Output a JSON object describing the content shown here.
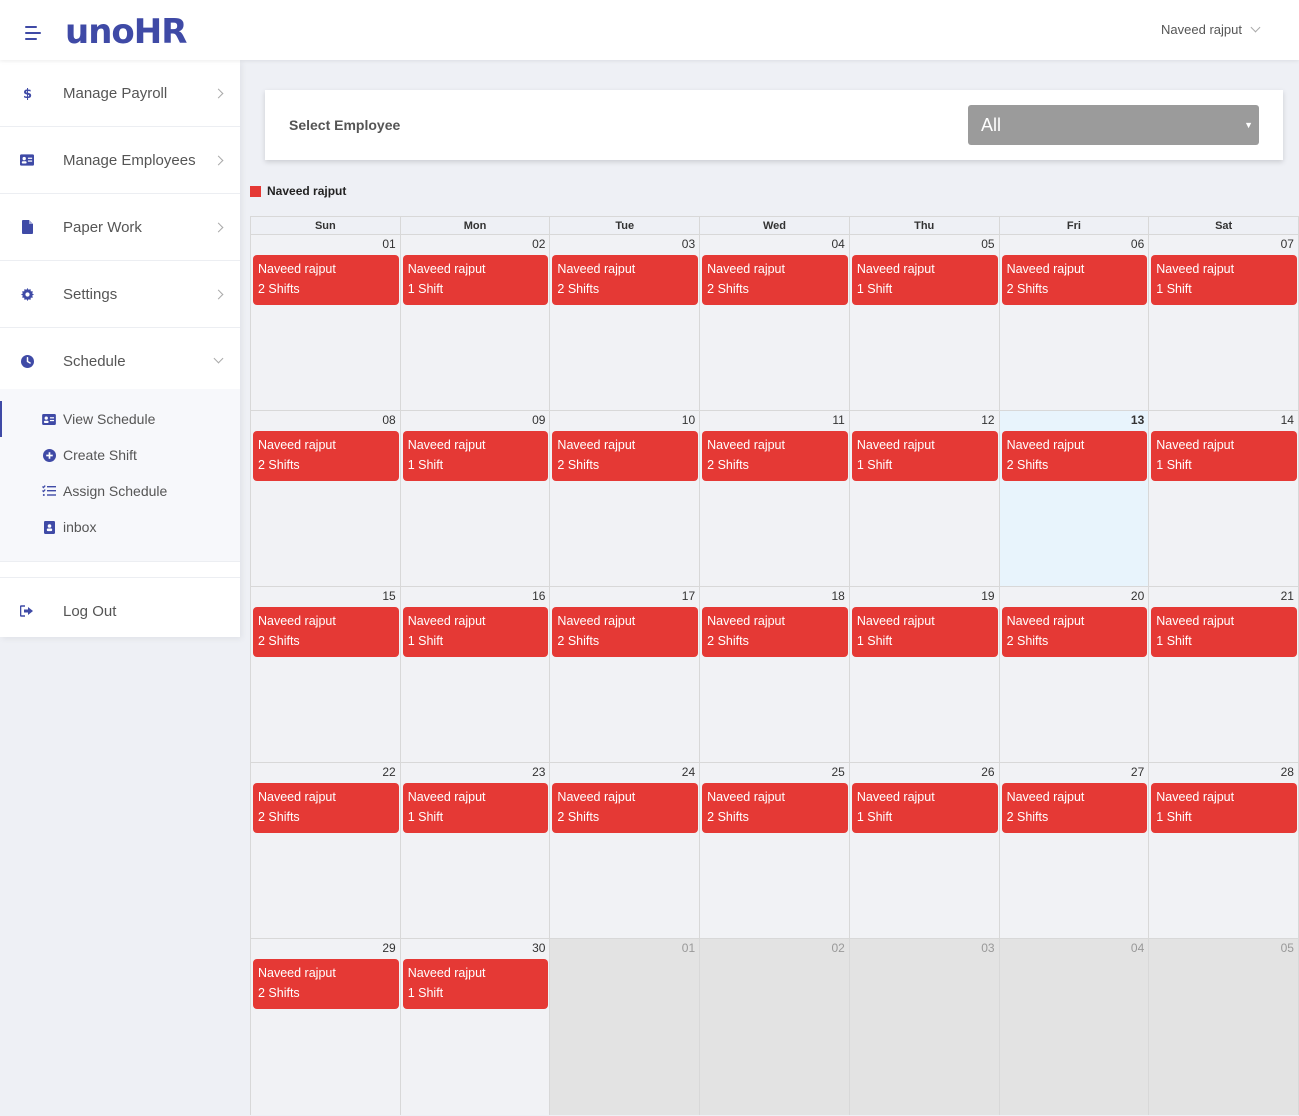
{
  "app": {
    "logo": "unoHR",
    "user_name": "Naveed rajput"
  },
  "sidebar": {
    "items": [
      {
        "label": "Manage Payroll",
        "icon": "dollar-icon"
      },
      {
        "label": "Manage Employees",
        "icon": "id-card-icon"
      },
      {
        "label": "Paper Work",
        "icon": "file-icon"
      },
      {
        "label": "Settings",
        "icon": "gear-icon"
      },
      {
        "label": "Schedule",
        "icon": "clock-icon"
      }
    ],
    "schedule_sub": [
      {
        "label": "View Schedule",
        "icon": "id-card-icon"
      },
      {
        "label": "Create Shift",
        "icon": "plus-circle-icon"
      },
      {
        "label": "Assign Schedule",
        "icon": "checklist-icon"
      },
      {
        "label": "inbox",
        "icon": "contact-book-icon"
      }
    ],
    "logout": {
      "label": "Log Out",
      "icon": "sign-out-icon"
    }
  },
  "filter": {
    "label": "Select Employee",
    "selected": "All"
  },
  "legend": {
    "label": "Naveed rajput",
    "color": "#e53935"
  },
  "calendar": {
    "weekdays": [
      "Sun",
      "Mon",
      "Tue",
      "Wed",
      "Thu",
      "Fri",
      "Sat"
    ],
    "today": "13",
    "weeks": [
      [
        {
          "day": "01",
          "name": "Naveed rajput",
          "shifts": "2 Shifts"
        },
        {
          "day": "02",
          "name": "Naveed rajput",
          "shifts": "1 Shift"
        },
        {
          "day": "03",
          "name": "Naveed rajput",
          "shifts": "2 Shifts"
        },
        {
          "day": "04",
          "name": "Naveed rajput",
          "shifts": "2 Shifts"
        },
        {
          "day": "05",
          "name": "Naveed rajput",
          "shifts": "1 Shift"
        },
        {
          "day": "06",
          "name": "Naveed rajput",
          "shifts": "2 Shifts"
        },
        {
          "day": "07",
          "name": "Naveed rajput",
          "shifts": "1 Shift"
        }
      ],
      [
        {
          "day": "08",
          "name": "Naveed rajput",
          "shifts": "2 Shifts"
        },
        {
          "day": "09",
          "name": "Naveed rajput",
          "shifts": "1 Shift"
        },
        {
          "day": "10",
          "name": "Naveed rajput",
          "shifts": "2 Shifts"
        },
        {
          "day": "11",
          "name": "Naveed rajput",
          "shifts": "2 Shifts"
        },
        {
          "day": "12",
          "name": "Naveed rajput",
          "shifts": "1 Shift"
        },
        {
          "day": "13",
          "name": "Naveed rajput",
          "shifts": "2 Shifts"
        },
        {
          "day": "14",
          "name": "Naveed rajput",
          "shifts": "1 Shift"
        }
      ],
      [
        {
          "day": "15",
          "name": "Naveed rajput",
          "shifts": "2 Shifts"
        },
        {
          "day": "16",
          "name": "Naveed rajput",
          "shifts": "1 Shift"
        },
        {
          "day": "17",
          "name": "Naveed rajput",
          "shifts": "2 Shifts"
        },
        {
          "day": "18",
          "name": "Naveed rajput",
          "shifts": "2 Shifts"
        },
        {
          "day": "19",
          "name": "Naveed rajput",
          "shifts": "1 Shift"
        },
        {
          "day": "20",
          "name": "Naveed rajput",
          "shifts": "2 Shifts"
        },
        {
          "day": "21",
          "name": "Naveed rajput",
          "shifts": "1 Shift"
        }
      ],
      [
        {
          "day": "22",
          "name": "Naveed rajput",
          "shifts": "2 Shifts"
        },
        {
          "day": "23",
          "name": "Naveed rajput",
          "shifts": "1 Shift"
        },
        {
          "day": "24",
          "name": "Naveed rajput",
          "shifts": "2 Shifts"
        },
        {
          "day": "25",
          "name": "Naveed rajput",
          "shifts": "2 Shifts"
        },
        {
          "day": "26",
          "name": "Naveed rajput",
          "shifts": "1 Shift"
        },
        {
          "day": "27",
          "name": "Naveed rajput",
          "shifts": "2 Shifts"
        },
        {
          "day": "28",
          "name": "Naveed rajput",
          "shifts": "1 Shift"
        }
      ],
      [
        {
          "day": "29",
          "name": "Naveed rajput",
          "shifts": "2 Shifts"
        },
        {
          "day": "30",
          "name": "Naveed rajput",
          "shifts": "1 Shift"
        },
        {
          "day": "01",
          "other_month": true
        },
        {
          "day": "02",
          "other_month": true
        },
        {
          "day": "03",
          "other_month": true
        },
        {
          "day": "04",
          "other_month": true
        },
        {
          "day": "05",
          "other_month": true
        }
      ]
    ]
  }
}
